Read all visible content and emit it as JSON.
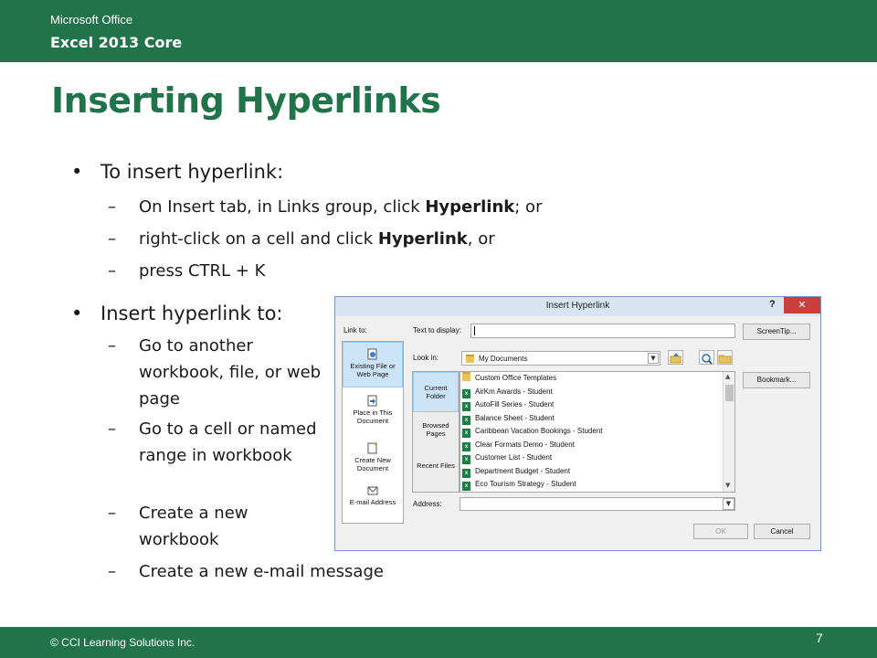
{
  "header": {
    "product": "Microsoft Office",
    "course": "Excel 2013 Core"
  },
  "title": "Inserting Hyperlinks",
  "section1": {
    "heading": "To insert hyperlink:",
    "items": [
      {
        "before": "On Insert tab, in Links group, click ",
        "bold": "Hyperlink",
        "after": "; or"
      },
      {
        "before": "right-click on a cell and click ",
        "bold": "Hyperlink",
        "after": ", or"
      },
      {
        "before": "press CTRL + K",
        "bold": "",
        "after": ""
      }
    ]
  },
  "section2": {
    "heading": "Insert hyperlink to:",
    "items": [
      "Go to another workbook, file, or web page",
      "Go to a cell or named range in workbook",
      "Create a new workbook",
      "Create a new e-mail message"
    ]
  },
  "dialog": {
    "title": "Insert Hyperlink",
    "help": "?",
    "close": "✕",
    "link_to_label": "Link to:",
    "text_to_display_label": "Text to display:",
    "text_to_display_value": "",
    "screentip_button": "ScreenTip...",
    "look_in_label": "Look in:",
    "look_in_value": "My Documents",
    "bookmark_button": "Bookmark...",
    "address_label": "Address:",
    "address_value": "",
    "ok_button": "OK",
    "cancel_button": "Cancel",
    "link_to_items": [
      {
        "label": "Existing File or Web Page",
        "selected": true
      },
      {
        "label": "Place in This Document",
        "selected": false
      },
      {
        "label": "Create New Document",
        "selected": false
      },
      {
        "label": "E-mail Address",
        "selected": false
      }
    ],
    "browse_tabs": [
      {
        "label": "Current Folder",
        "selected": true
      },
      {
        "label": "Browsed Pages",
        "selected": false
      },
      {
        "label": "Recent Files",
        "selected": false
      }
    ],
    "files": [
      {
        "name": "Custom Office Templates",
        "type": "folder"
      },
      {
        "name": "AirKm Awards - Student",
        "type": "xls"
      },
      {
        "name": "AutoFill Series - Student",
        "type": "xls"
      },
      {
        "name": "Balance Sheet - Student",
        "type": "xls"
      },
      {
        "name": "Caribbean Vacation Bookings - Student",
        "type": "xls"
      },
      {
        "name": "Clear Formats Demo - Student",
        "type": "xls"
      },
      {
        "name": "Customer List - Student",
        "type": "xls"
      },
      {
        "name": "Department Budget - Student",
        "type": "xls"
      },
      {
        "name": "Eco Tourism Strategy - Student",
        "type": "xls"
      }
    ]
  },
  "footer": {
    "copyright": "© CCI Learning Solutions Inc.",
    "page": "7"
  },
  "colors": {
    "brand_green": "#21734a",
    "selection_blue": "#cce4f7",
    "close_red": "#c7403a"
  }
}
